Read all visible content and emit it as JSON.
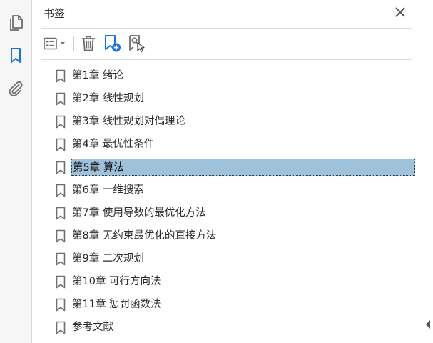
{
  "rail": {
    "items": [
      {
        "name": "pages-thumbnails-button",
        "icon": "pages-icon",
        "active": false
      },
      {
        "name": "bookmarks-button",
        "icon": "bookmark-icon",
        "active": true
      },
      {
        "name": "attachments-button",
        "icon": "paperclip-icon",
        "active": false
      }
    ]
  },
  "panel": {
    "title": "书签",
    "close_icon": "close-icon"
  },
  "toolbar": {
    "options_icon": "list-options-icon",
    "delete_icon": "trash-icon",
    "new_bookmark_icon": "new-bookmark-icon",
    "find_bookmark_icon": "find-current-bookmark-icon"
  },
  "bookmarks": [
    {
      "label": "第1章 绪论",
      "selected": false
    },
    {
      "label": "第2章 线性规划",
      "selected": false
    },
    {
      "label": "第3章 线性规划对偶理论",
      "selected": false
    },
    {
      "label": "第4章 最优性条件",
      "selected": false
    },
    {
      "label": "第5章 算法",
      "selected": true
    },
    {
      "label": "第6章 一维搜索",
      "selected": false
    },
    {
      "label": "第7章 使用导数的最优化方法",
      "selected": false
    },
    {
      "label": "第8章 无约束最优化的直接方法",
      "selected": false
    },
    {
      "label": "第9章 二次规划",
      "selected": false
    },
    {
      "label": "第10章 可行方向法",
      "selected": false
    },
    {
      "label": "第11章 惩罚函数法",
      "selected": false
    },
    {
      "label": "参考文献",
      "selected": false
    }
  ],
  "colors": {
    "accent": "#1473e6",
    "selection": "#9ec1dc",
    "icon": "#6e6e6e"
  }
}
